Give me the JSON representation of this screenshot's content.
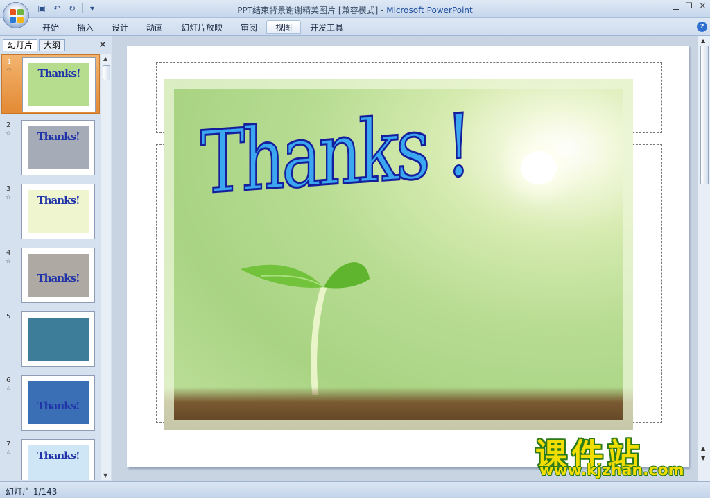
{
  "window": {
    "title": "PPT结束背景谢谢精美图片 [兼容模式]",
    "title_sep": " - ",
    "app_name": "Microsoft PowerPoint"
  },
  "quick_access": [
    {
      "name": "save-icon",
      "glyph": "▣"
    },
    {
      "name": "undo-icon",
      "glyph": "↶"
    },
    {
      "name": "redo-icon",
      "glyph": "↻"
    },
    {
      "name": "customize-qat-icon",
      "glyph": "▾"
    }
  ],
  "ribbon": {
    "tabs": [
      "开始",
      "插入",
      "设计",
      "动画",
      "幻灯片放映",
      "审阅",
      "视图",
      "开发工具"
    ],
    "active_tab": "视图",
    "help": "?"
  },
  "pane": {
    "tabs": [
      "幻灯片",
      "大纲"
    ],
    "active_tab": "幻灯片",
    "close": "✕",
    "slides": [
      {
        "num": "1",
        "text": "Thanks!",
        "bg": "#b6dc8e",
        "selected": true
      },
      {
        "num": "2",
        "text": "Thanks!",
        "bg": "#a5acb8",
        "selected": false
      },
      {
        "num": "3",
        "text": "Thanks!",
        "bg": "#eef5cf",
        "selected": false
      },
      {
        "num": "4",
        "text": "Thanks!",
        "bg": "#aea9a2",
        "selected": false
      },
      {
        "num": "5",
        "text": "",
        "bg": "#3d7d99",
        "selected": false
      },
      {
        "num": "6",
        "text": "Thanks!",
        "bg": "#3b6fb5",
        "selected": false
      },
      {
        "num": "7",
        "text": "Thanks!",
        "bg": "#cfe6f6",
        "selected": false
      }
    ]
  },
  "slide": {
    "headline": "Thanks !"
  },
  "status": {
    "text": "幻灯片 1/143"
  },
  "watermark": {
    "main": "课件站",
    "url": "www.kjzhan.com"
  }
}
